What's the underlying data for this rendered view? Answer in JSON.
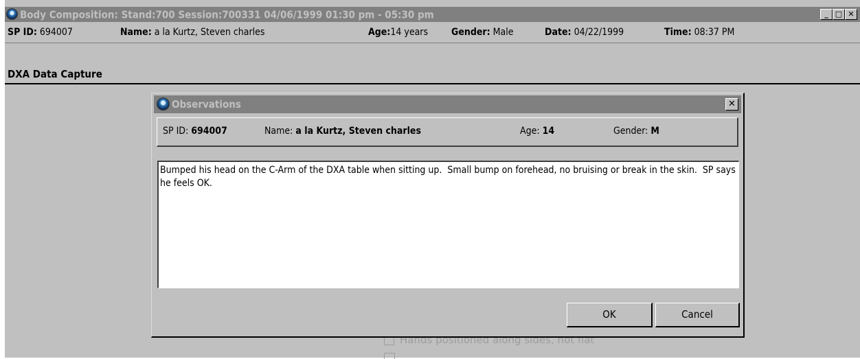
{
  "window": {
    "title": "Body Composition: Stand:700 Session:700331 04/06/1999 01:30 pm - 05:30 pm",
    "controls": {
      "minimize": "_",
      "maximize": "□",
      "close": "✕"
    }
  },
  "info_bar": {
    "sp_id_label": "SP ID:",
    "sp_id_value": "694007",
    "name_label": "Name:",
    "name_value": "a la Kurtz, Steven charles",
    "age_label": "Age:",
    "age_value": "14 years",
    "gender_label": "Gender:",
    "gender_value": "Male",
    "date_label": "Date:",
    "date_value": "04/22/1999",
    "time_label": "Time:",
    "time_value": "08:37 PM"
  },
  "section": {
    "title": "DXA Data Capture"
  },
  "background_checkbox": {
    "label": "Hands positioned along sides, not flat"
  },
  "dialog": {
    "title": "Observations",
    "close": "✕",
    "header": {
      "sp_id_label": "SP ID:",
      "sp_id_value": "694007",
      "name_label": "Name:",
      "name_value": "a la Kurtz, Steven charles",
      "age_label": "Age:",
      "age_value": "14",
      "gender_label": "Gender:",
      "gender_value": "M"
    },
    "observation_text": "Bumped his head on the C-Arm of the DXA table when sitting up.  Small bump on forehead, no bruising or break in the skin.  SP says he feels OK.",
    "ok_label": "OK",
    "cancel_label": "Cancel"
  },
  "icons": {
    "app": "app-globe-icon"
  }
}
